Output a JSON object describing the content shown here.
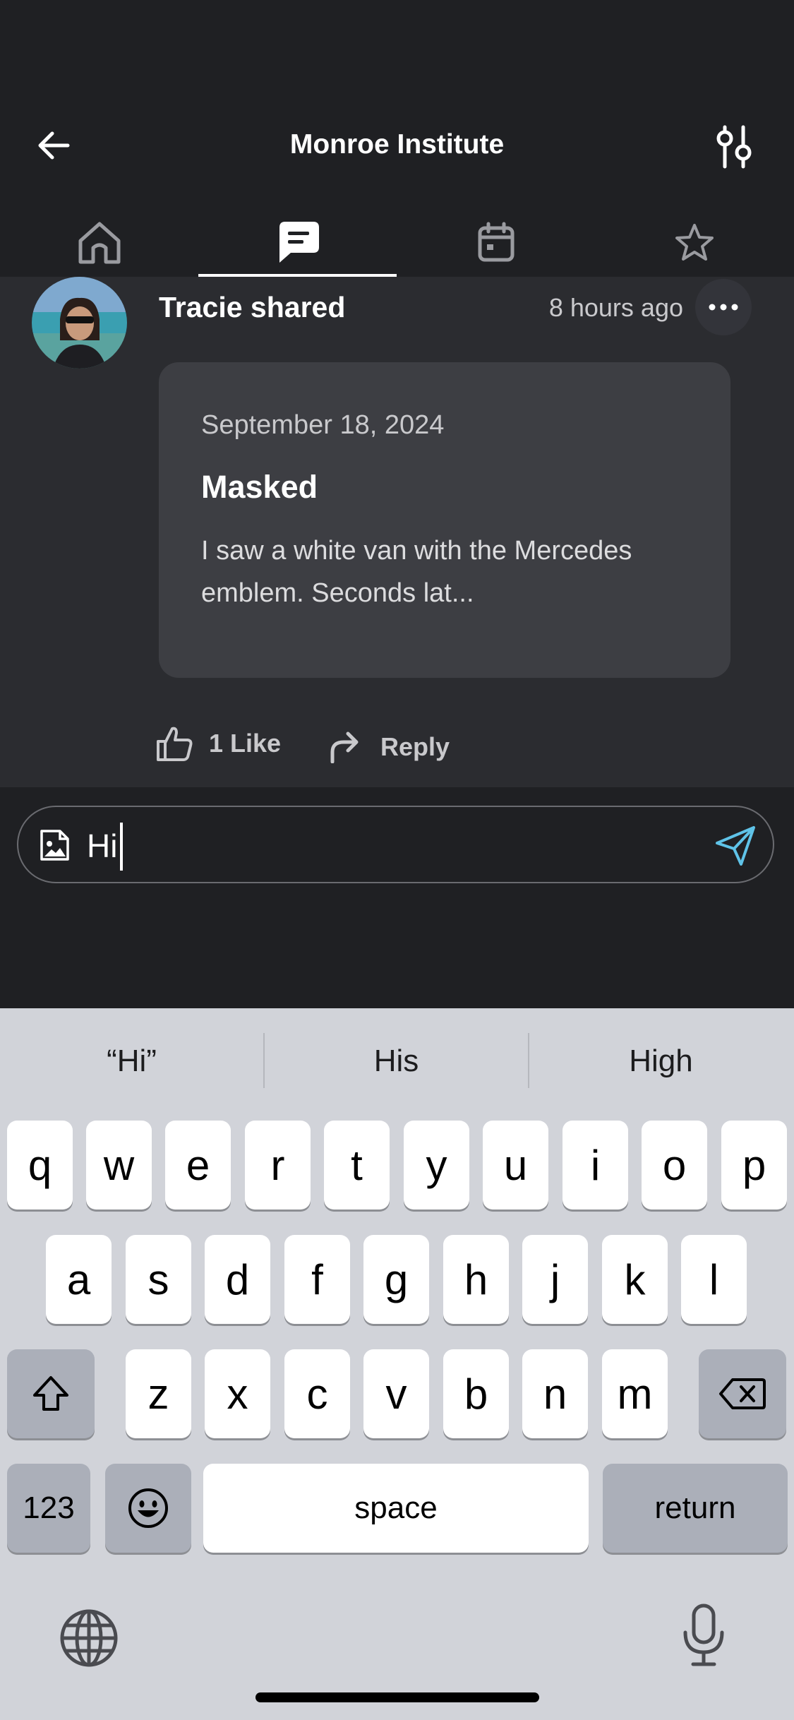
{
  "header": {
    "title": "Monroe Institute"
  },
  "tabs": [
    {
      "icon": "home-icon"
    },
    {
      "icon": "chat-icon",
      "active": true
    },
    {
      "icon": "calendar-icon"
    },
    {
      "icon": "star-icon"
    }
  ],
  "post": {
    "author": "Tracie shared",
    "time": "8 hours ago",
    "card": {
      "date": "September 18, 2024",
      "title": "Masked",
      "body": "I saw a white van with the Mercedes emblem. Seconds lat..."
    },
    "like_label": "1 Like",
    "reply_label": "Reply"
  },
  "comment": {
    "value": "Hi"
  },
  "keyboard": {
    "suggestions": [
      "“Hi”",
      "His",
      "High"
    ],
    "row1": [
      "q",
      "w",
      "e",
      "r",
      "t",
      "y",
      "u",
      "i",
      "o",
      "p"
    ],
    "row2": [
      "a",
      "s",
      "d",
      "f",
      "g",
      "h",
      "j",
      "k",
      "l"
    ],
    "row3": [
      "z",
      "x",
      "c",
      "v",
      "b",
      "n",
      "m"
    ],
    "numbers_label": "123",
    "space_label": "space",
    "return_label": "return"
  },
  "colors": {
    "background": "#1f2023",
    "feed": "#2b2c30",
    "card": "#3d3e43",
    "accent": "#5fc3e8"
  }
}
